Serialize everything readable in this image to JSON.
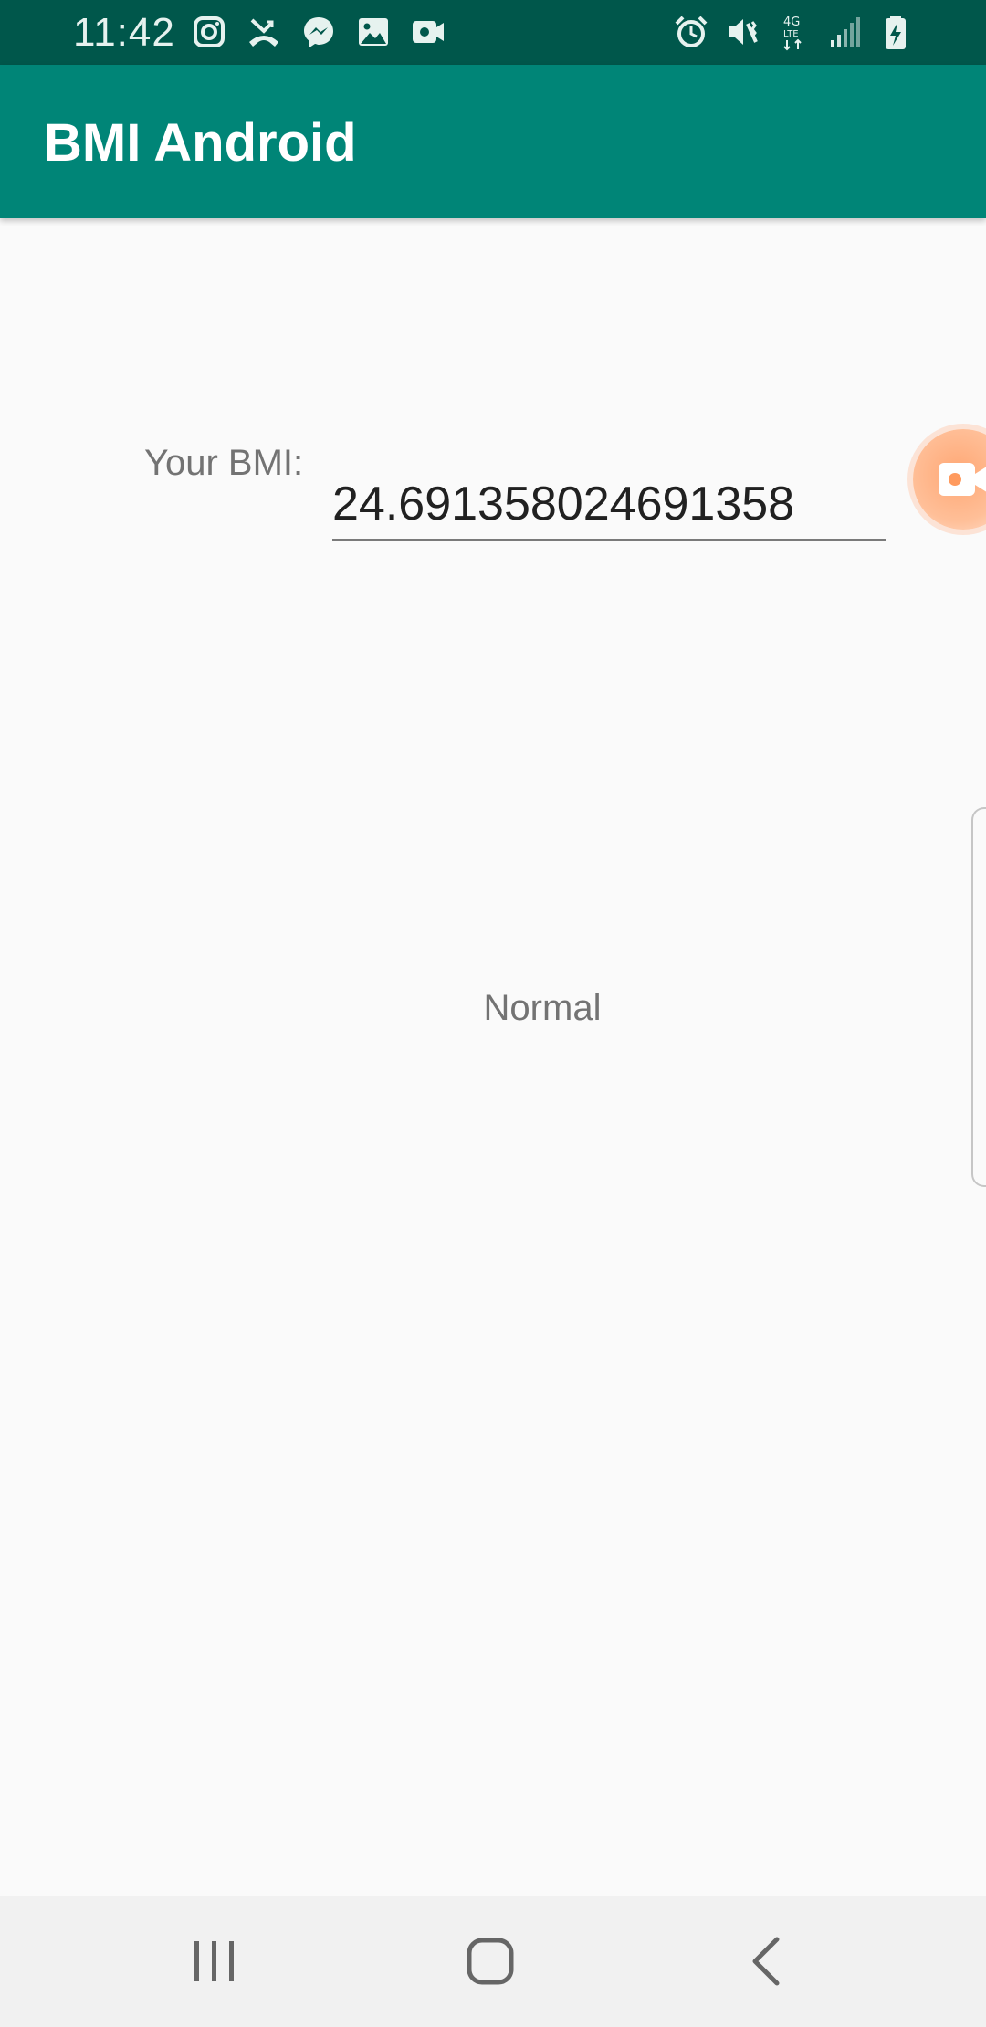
{
  "status_bar": {
    "time": "11:42",
    "left_icons": [
      "instagram-icon",
      "missed-call-icon",
      "messenger-icon",
      "gallery-icon",
      "video-recorder-icon"
    ],
    "right_icons": [
      "alarm-icon",
      "mute-vibrate-icon",
      "lte-4g-icon",
      "signal-icon",
      "battery-charging-icon"
    ]
  },
  "app_bar": {
    "title": "BMI Android",
    "color": "#008577"
  },
  "main": {
    "bmi_label": "Your BMI:",
    "bmi_value": "24.691358024691358",
    "category": "Normal"
  },
  "overlays": {
    "recorder_bubble_icon": "video-camera-icon",
    "edge_panel_handle": "edge-panel-handle"
  },
  "nav_bar": {
    "buttons": [
      "recents-icon",
      "home-icon",
      "back-icon"
    ]
  },
  "colors": {
    "status_bar": "#00574b",
    "primary": "#008577",
    "background": "#fafafa"
  }
}
